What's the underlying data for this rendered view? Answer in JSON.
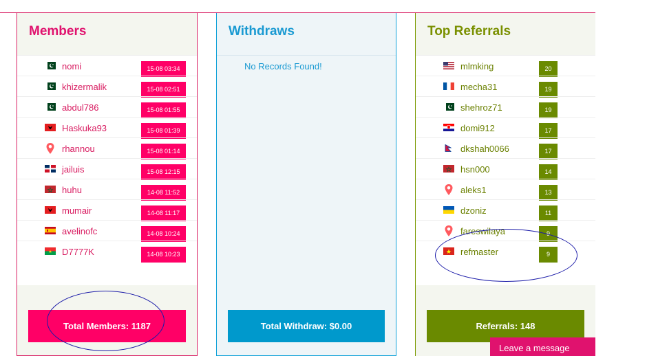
{
  "members": {
    "title": "Members",
    "rows": [
      {
        "flag": "pk",
        "name": "nomi",
        "time": "15-08 03:34"
      },
      {
        "flag": "pk",
        "name": "khizermalik",
        "time": "15-08 02:51"
      },
      {
        "flag": "pk",
        "name": "abdul786",
        "time": "15-08 01:55"
      },
      {
        "flag": "al",
        "name": "Haskuka93",
        "time": "15-08 01:39"
      },
      {
        "flag": "pin",
        "name": "rhannou",
        "time": "15-08 01:14"
      },
      {
        "flag": "do",
        "name": "jailuis",
        "time": "15-08 12:15"
      },
      {
        "flag": "ma",
        "name": "huhu",
        "time": "14-08 11:52"
      },
      {
        "flag": "al",
        "name": "mumair",
        "time": "14-08 11:17"
      },
      {
        "flag": "es",
        "name": "avelinofc",
        "time": "14-08 10:24"
      },
      {
        "flag": "bf",
        "name": "D7777K",
        "time": "14-08 10:23"
      }
    ],
    "total_label": "Total Members: 1187"
  },
  "withdraws": {
    "title": "Withdraws",
    "empty_text": "No Records Found!",
    "total_label": "Total Withdraw: $0.00"
  },
  "referrals": {
    "title": "Top Referrals",
    "rows": [
      {
        "flag": "us",
        "name": "mlmking",
        "count": "20"
      },
      {
        "flag": "fr",
        "name": "mecha31",
        "count": "19"
      },
      {
        "flag": "pk",
        "name": "shehroz71",
        "count": "19"
      },
      {
        "flag": "hr",
        "name": "domi912",
        "count": "17"
      },
      {
        "flag": "np",
        "name": "dkshah0066",
        "count": "17"
      },
      {
        "flag": "ma",
        "name": "hsn000",
        "count": "14"
      },
      {
        "flag": "pin",
        "name": "aleks1",
        "count": "13"
      },
      {
        "flag": "ua",
        "name": "dzoniz",
        "count": "11"
      },
      {
        "flag": "pin",
        "name": "fareswilaya",
        "count": "9"
      },
      {
        "flag": "vn",
        "name": "refmaster",
        "count": "9"
      }
    ],
    "total_label": "Referrals: 148"
  },
  "chat": {
    "label": "Leave a message"
  },
  "colors": {
    "members_accent": "#ff0066",
    "withdraws_accent": "#0099cc",
    "referrals_accent": "#6a8a00"
  }
}
